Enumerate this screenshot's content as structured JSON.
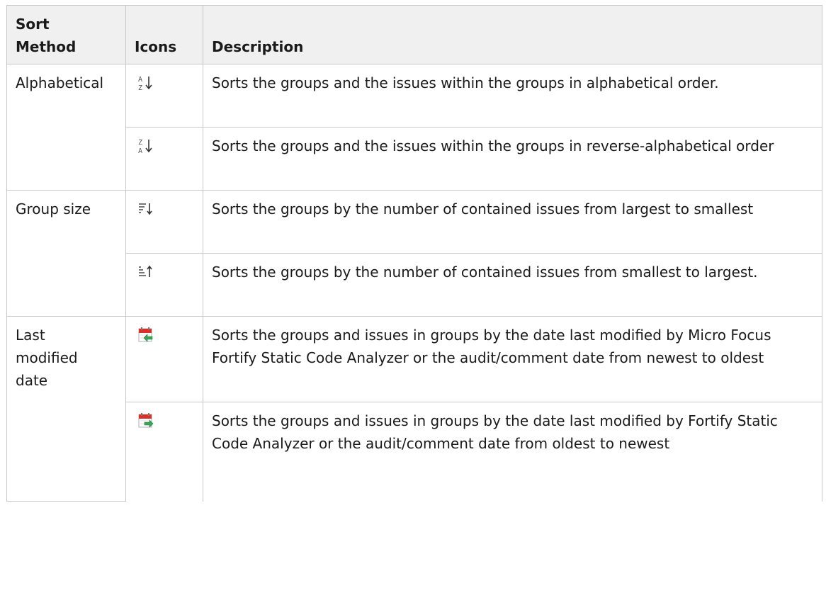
{
  "headers": {
    "method": "Sort Method",
    "icons": "Icons",
    "description": "Description"
  },
  "rows": [
    {
      "method": "Alphabetical",
      "icon": "sort-a-z-icon",
      "description": "Sorts the groups and the issues within the groups in alphabetical order."
    },
    {
      "method": "",
      "icon": "sort-z-a-icon",
      "description": "Sorts the groups and the issues within the groups in reverse-alphabetical order"
    },
    {
      "method": "Group size",
      "icon": "sort-size-descending-icon",
      "description": "Sorts the groups by the number of contained issues from largest to smallest"
    },
    {
      "method": "",
      "icon": "sort-size-ascending-icon",
      "description": "Sorts the groups by the number of contained issues from smallest to largest."
    },
    {
      "method": "Last modified date",
      "icon": "calendar-newest-first-icon",
      "description": "Sorts the groups and issues in groups by the date last modified by Micro Focus Fortify Static Code Analyzer or the audit/comment date from newest to oldest"
    },
    {
      "method": "",
      "icon": "calendar-oldest-first-icon",
      "description": "Sorts the groups and issues in groups by the date last modified by Fortify Static Code Analyzer or the audit/comment date from oldest to newest"
    }
  ],
  "colors": {
    "header_bg": "#f0f0f0",
    "border": "#c8c8c8",
    "calendar_red": "#d9302a",
    "arrow_green": "#3aa35a"
  }
}
